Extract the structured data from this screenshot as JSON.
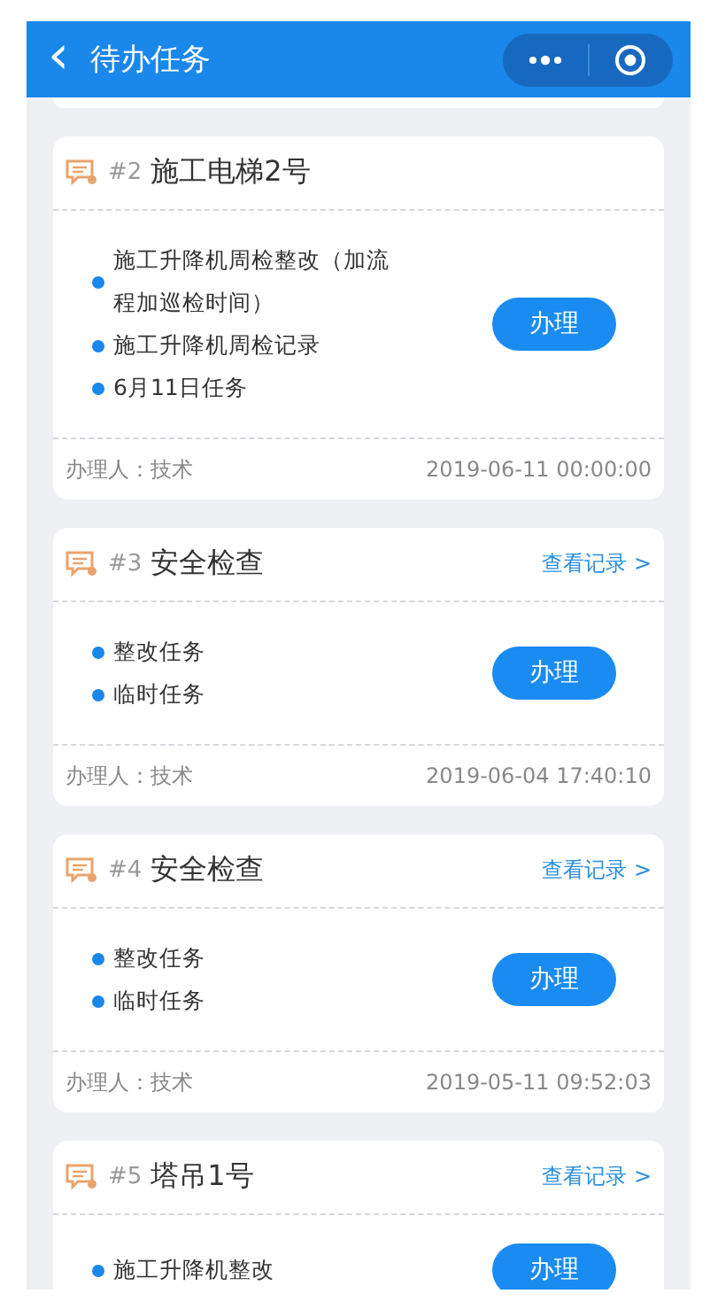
{
  "header": {
    "back_icon": "‹",
    "title": "待办任务"
  },
  "tasks": [
    {
      "number": "#2",
      "title": "施工电梯2号",
      "items": [
        "施工升降机周检整改（加流程加巡检时间）",
        "施工升降机周检记录",
        "6月11日任务"
      ],
      "button": "办理",
      "handler": "办理人：技术",
      "time": "2019-06-11 00:00:00"
    },
    {
      "number": "#3",
      "title": "安全检查",
      "link": "查看记录 >",
      "items": [
        "整改任务",
        "临时任务"
      ],
      "button": "办理",
      "handler": "办理人：技术",
      "time": "2019-06-04 17:40:10"
    },
    {
      "number": "#4",
      "title": "安全检查",
      "link": "查看记录 >",
      "items": [
        "整改任务",
        "临时任务"
      ],
      "button": "办理",
      "handler": "办理人：技术",
      "time": "2019-05-11 09:52:03"
    },
    {
      "number": "#5",
      "title": "塔吊1号",
      "link": "查看记录 >",
      "items": [
        "施工升降机整改"
      ],
      "button": "办理"
    }
  ]
}
